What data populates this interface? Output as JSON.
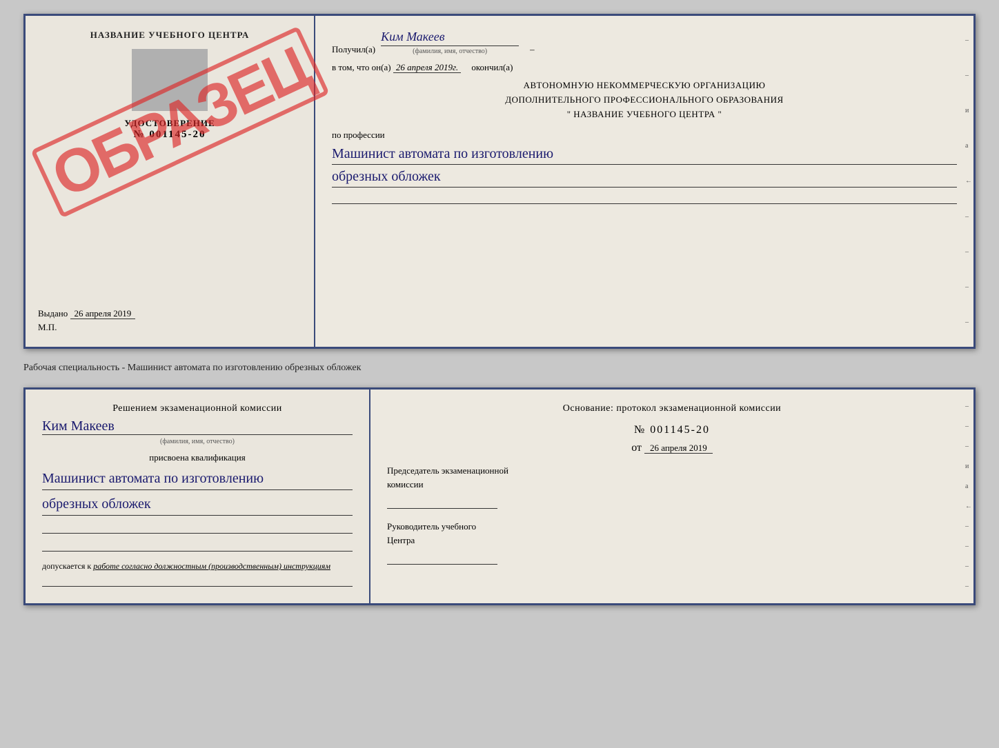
{
  "doc1": {
    "left": {
      "title": "НАЗВАНИЕ УЧЕБНОГО ЦЕНТРА",
      "stamp": "ОБРАЗЕЦ",
      "udostoverenie_label": "УДОСТОВЕРЕНИЕ",
      "number": "№ 001145-20",
      "vydano_label": "Выдано",
      "vydano_date": "26 апреля 2019",
      "mp": "М.П."
    },
    "right": {
      "poluchil_label": "Получил(а)",
      "poluchil_name": "Ким Макеев",
      "fio_hint": "(фамилия, имя, отчество)",
      "v_tom_label": "в том, что он(а)",
      "date_value": "26 апреля 2019г.",
      "okonchil_label": "окончил(а)",
      "org_line1": "АВТОНОМНУЮ НЕКОММЕРЧЕСКУЮ ОРГАНИЗАЦИЮ",
      "org_line2": "ДОПОЛНИТЕЛЬНОГО ПРОФЕССИОНАЛЬНОГО ОБРАЗОВАНИЯ",
      "org_quote1": "\"",
      "org_name": "НАЗВАНИЕ УЧЕБНОГО ЦЕНТРА",
      "org_quote2": "\"",
      "po_professii": "по профессии",
      "profession1": "Машинист автомата по изготовлению",
      "profession2": "обрезных обложек"
    }
  },
  "separator": {
    "text": "Рабочая специальность - Машинист автомата по изготовлению обрезных обложек"
  },
  "doc2": {
    "left": {
      "reshenie_label": "Решением экзаменационной комиссии",
      "name": "Ким Макеев",
      "fio_hint": "(фамилия, имя, отчество)",
      "prisvoena_label": "присвоена квалификация",
      "kvali1": "Машинист автомата по изготовлению",
      "kvali2": "обрезных обложек",
      "dopuskaetsya_label": "допускается к",
      "dopuskaetsya_value": "работе согласно должностным (производственным) инструкциям"
    },
    "right": {
      "osnovanie_label": "Основание: протокол экзаменационной комиссии",
      "protocol_number": "№ 001145-20",
      "ot_label": "от",
      "ot_date": "26 апреля 2019",
      "predsedatel_label": "Председатель экзаменационной",
      "komissia_label": "комиссии",
      "rukovoditel_label": "Руководитель учебного",
      "centr_label": "Центра"
    }
  }
}
